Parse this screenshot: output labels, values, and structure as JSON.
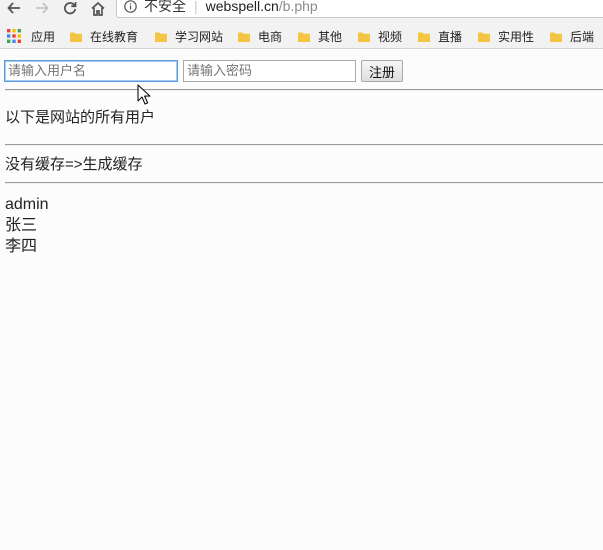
{
  "address_bar": {
    "secure_label": "不安全",
    "url_domain": "webspell.cn",
    "url_path": "/b.php"
  },
  "bookmarks": [
    {
      "label": "应用",
      "icon": "apps-grid-icon"
    },
    {
      "label": "在线教育",
      "icon": "folder-icon"
    },
    {
      "label": "学习网站",
      "icon": "folder-icon"
    },
    {
      "label": "电商",
      "icon": "folder-icon"
    },
    {
      "label": "其他",
      "icon": "folder-icon"
    },
    {
      "label": "视频",
      "icon": "folder-icon"
    },
    {
      "label": "直播",
      "icon": "folder-icon"
    },
    {
      "label": "实用性",
      "icon": "folder-icon"
    },
    {
      "label": "后端",
      "icon": "folder-icon"
    }
  ],
  "form": {
    "username_placeholder": "请输入用户名",
    "password_placeholder": "请输入密码",
    "register_label": "注册"
  },
  "content": {
    "heading": "以下是网站的所有用户",
    "cache_status": "没有缓存=>生成缓存",
    "users": [
      "admin",
      "张三",
      "李四"
    ]
  },
  "colors": {
    "folder": "#f4c542",
    "focus_border": "#5b9dd9"
  }
}
